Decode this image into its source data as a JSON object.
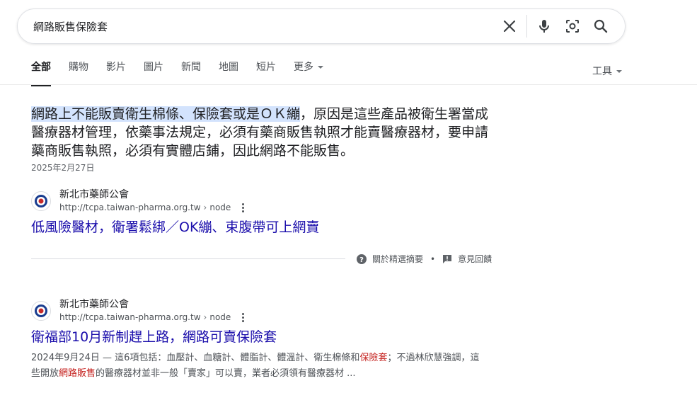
{
  "search": {
    "query": "網路販售保險套"
  },
  "icons": {
    "clear": "close-icon",
    "voice": "mic-icon",
    "lens": "camera-lens-icon",
    "search": "search-icon"
  },
  "tabs": [
    {
      "label": "全部",
      "active": true
    },
    {
      "label": "購物"
    },
    {
      "label": "影片"
    },
    {
      "label": "圖片"
    },
    {
      "label": "新聞"
    },
    {
      "label": "地圖"
    },
    {
      "label": "短片"
    },
    {
      "label": "更多"
    }
  ],
  "tools_label": "工具",
  "featured_snippet": {
    "highlight": "網路上不能販賣衛生棉條、保險套或是ＯＫ繃",
    "rest": "，原因是這些產品被衛生署當成醫療器材管理，依藥事法規定，必須有藥商販售執照才能賣醫療器材，要申請藥商販售執照，必須有實體店鋪，因此網路不能販售。",
    "date": "2025年2月27日"
  },
  "results": [
    {
      "site": "新北市藥師公會",
      "url": "http://tcpa.taiwan-pharma.org.tw",
      "path": "node",
      "title": "低風險醫材，衛署鬆綁／OK繃、束腹帶可上網賣"
    },
    {
      "site": "新北市藥師公會",
      "url": "http://tcpa.taiwan-pharma.org.tw",
      "path": "node",
      "title": "衛福部10月新制趕上路，網路可賣保險套",
      "desc_1": "2024年9月24日 — 這6項包括：血壓計、血糖計、體脂計、體溫計、衛生棉條和",
      "desc_em_1": "保險套",
      "desc_2": "；不過林欣慧強調，這些開放",
      "desc_em_2": "網路販售",
      "desc_3": "的醫療器材並非一般「賣家」可以賣，業者必須領有醫療器材 ..."
    }
  ],
  "feedback": {
    "about_label": "關於精選摘要",
    "dot": "•",
    "feedback_label": "意見回饋"
  },
  "colors": {
    "link": "#1a0dab",
    "highlight": "#d3e3fd",
    "emphasis": "#c5221f"
  }
}
